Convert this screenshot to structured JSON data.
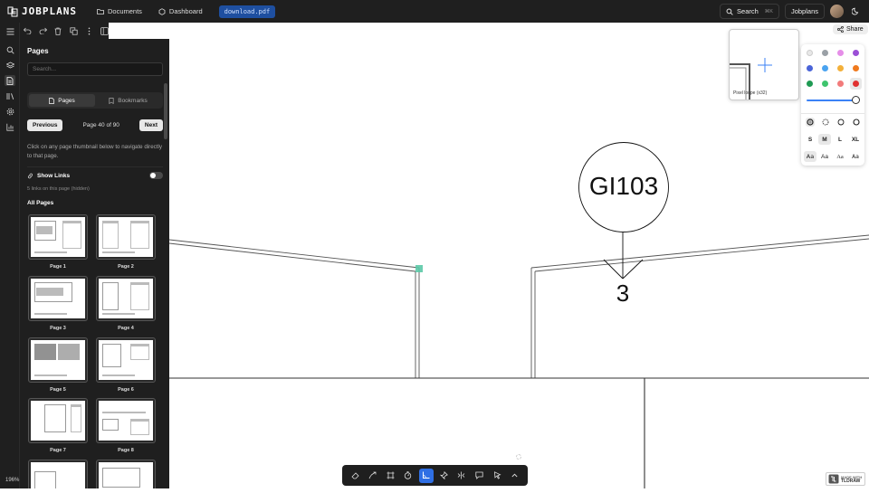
{
  "app": {
    "name": "JOBPLANS"
  },
  "nav": {
    "documents": "Documents",
    "dashboard": "Dashboard",
    "file_chip": "download.pdf"
  },
  "topright": {
    "search_label": "Search",
    "search_kbd": "⌘K",
    "user_label": "Jobplans"
  },
  "sidebar": {
    "title": "Pages",
    "search_placeholder": "Search...",
    "tabs": [
      {
        "label": "Pages",
        "active": true
      },
      {
        "label": "Bookmarks",
        "active": false
      }
    ],
    "prev_label": "Previous",
    "next_label": "Next",
    "page_info": "Page 40 of 90",
    "hint": "Click on any page thumbnail below to navigate directly to that page.",
    "show_links_label": "Show Links",
    "links_count": "5 links on this page (hidden)",
    "all_pages_label": "All Pages",
    "pages": [
      "Page 1",
      "Page 2",
      "Page 3",
      "Page 4",
      "Page 5",
      "Page 6",
      "Page 7",
      "Page 8"
    ]
  },
  "zoom": "196%",
  "share_label": "Share",
  "loupe_label": "Pixel loupe (x32)",
  "drawing": {
    "callout": "GI103",
    "number": "3"
  },
  "style_panel": {
    "colors": [
      "#e8e8e8",
      "#9aa0a6",
      "#e58ee8",
      "#9b4fd6",
      "#4a64d8",
      "#4aa3f0",
      "#f3b03a",
      "#f07a1e",
      "#1f9a53",
      "#3ec46d",
      "#f27b7b",
      "#e03131"
    ],
    "size_options": [
      "S",
      "M",
      "L",
      "XL"
    ],
    "size_selected": "M",
    "font_options": [
      "Aa",
      "Aa",
      "Aa",
      "Aa"
    ]
  },
  "made_with": {
    "line1": "MADE WITH",
    "line2": "TLDRAW"
  }
}
